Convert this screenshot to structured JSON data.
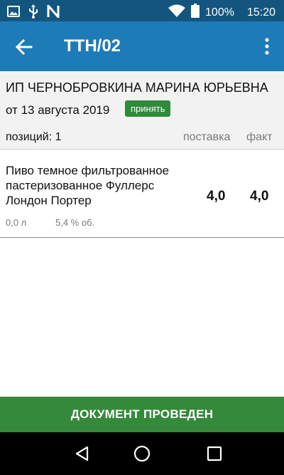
{
  "status_bar": {
    "battery_percent": "100%",
    "time": "15:20",
    "icons": [
      "image-icon",
      "usb-icon",
      "n-icon",
      "wifi-icon",
      "battery-icon"
    ]
  },
  "app_bar": {
    "title": "ТТН/02",
    "back_icon": "arrow-left-icon",
    "menu_icon": "more-vert-icon"
  },
  "document": {
    "organization": "ИП ЧЕРНОБРОВКИНА МАРИНА ЮРЬЕВНА",
    "date": "от 13 августа 2019",
    "accept_badge": "принять",
    "positions_label": "позиций: 1",
    "columns": {
      "supply": "поставка",
      "fact": "факт"
    }
  },
  "items": [
    {
      "name": "Пиво темное фильтрованное пастеризованное Фуллерс Лондон Портер",
      "supply": "4,0",
      "fact": "4,0",
      "volume": "0,0 л",
      "abv": "5,4 % об."
    }
  ],
  "footer": {
    "action_label": "ДОКУМЕНТ ПРОВЕДЕН"
  },
  "nav_bar": {
    "icons": [
      "back-triangle-icon",
      "home-circle-icon",
      "recents-square-icon"
    ]
  },
  "colors": {
    "status_bar": "#13557f",
    "app_bar": "#1d7bb8",
    "accept_badge": "#2f8a3a",
    "action_bar": "#35893b"
  }
}
